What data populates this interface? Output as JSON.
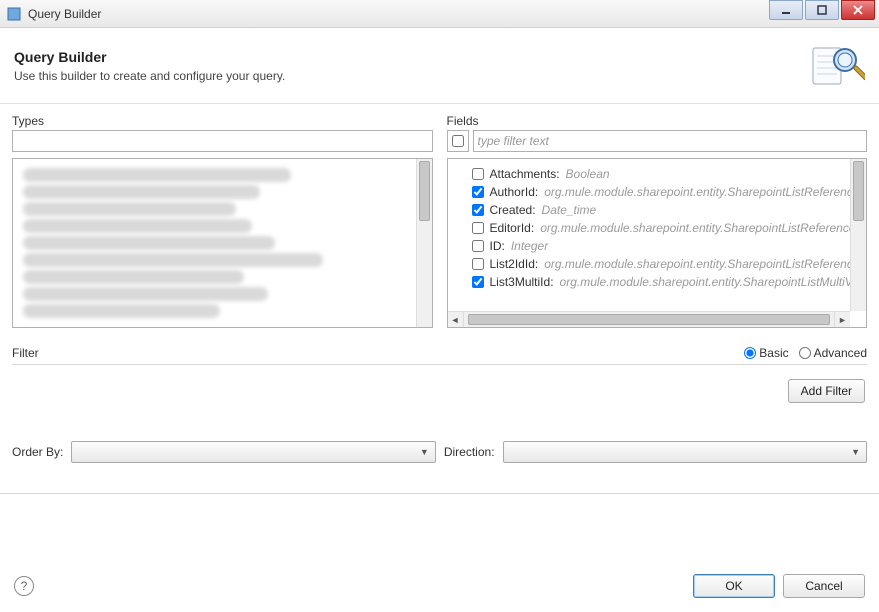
{
  "window": {
    "title": "Query Builder"
  },
  "header": {
    "title": "Query Builder",
    "subtitle": "Use this builder to create and configure your query."
  },
  "types": {
    "label": "Types",
    "value": ""
  },
  "fields": {
    "label": "Fields",
    "filter_placeholder": "type filter text",
    "select_all_checked": false,
    "items": [
      {
        "name": "Attachments:",
        "type": "Boolean",
        "checked": false
      },
      {
        "name": "AuthorId:",
        "type": "org.mule.module.sharepoint.entity.SharepointListReference",
        "checked": true
      },
      {
        "name": "Created:",
        "type": "Date_time",
        "checked": true
      },
      {
        "name": "EditorId:",
        "type": "org.mule.module.sharepoint.entity.SharepointListReference",
        "checked": false
      },
      {
        "name": "ID:",
        "type": "Integer",
        "checked": false
      },
      {
        "name": "List2IdId:",
        "type": "org.mule.module.sharepoint.entity.SharepointListReference",
        "checked": false
      },
      {
        "name": "List3MultiId:",
        "type": "org.mule.module.sharepoint.entity.SharepointListMultiV",
        "checked": true
      }
    ]
  },
  "filter": {
    "label": "Filter",
    "mode_basic": "Basic",
    "mode_advanced": "Advanced",
    "selected_mode": "basic",
    "add_filter_label": "Add Filter"
  },
  "orderby": {
    "label": "Order By:",
    "direction_label": "Direction:"
  },
  "footer": {
    "ok_label": "OK",
    "cancel_label": "Cancel"
  }
}
